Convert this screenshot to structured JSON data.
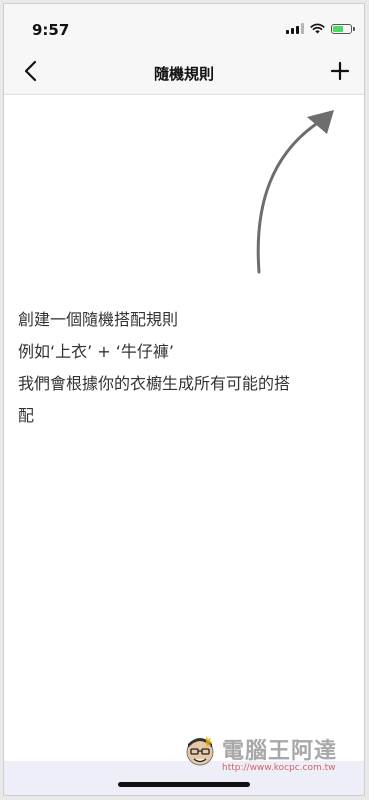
{
  "status_bar": {
    "time": "9:57",
    "signal_icon": "signal-icon",
    "wifi_icon": "wifi-icon",
    "battery_icon": "battery-charging-icon",
    "battery_color": "#4cd964"
  },
  "nav": {
    "back_icon": "chevron-left-icon",
    "title": "隨機規則",
    "add_icon": "plus-icon"
  },
  "empty_state": {
    "lines": [
      "創建一個隨機搭配規則",
      "例如‘上衣’ + ‘牛仔褲’",
      "我們會根據你的衣櫥生成所有可能的搭",
      "配"
    ],
    "arrow_icon": "arrow-up-right-icon"
  },
  "watermark": {
    "title": "電腦王阿達",
    "url": "http://www.kocpc.com.tw"
  }
}
